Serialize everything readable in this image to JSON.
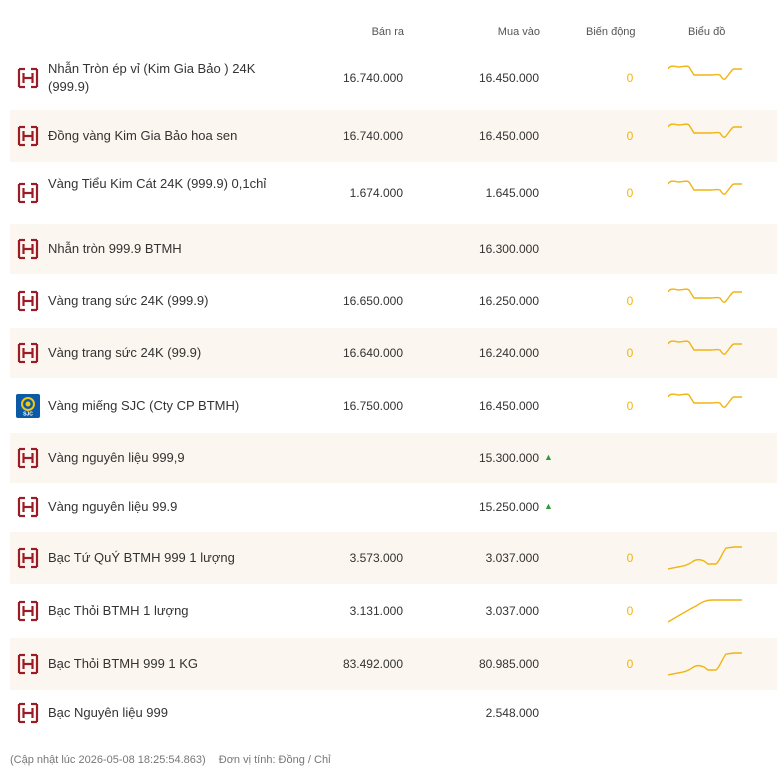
{
  "headers": {
    "sell": "Bán ra",
    "buy": "Mua vào",
    "change": "Biến động",
    "chart": "Biểu đồ"
  },
  "rows": [
    {
      "name": "Nhẫn Tròn ép vỉ (Kim Gia Bảo ) 24K (999.9)",
      "sell": "16.740.000",
      "buy": "16.450.000",
      "change": "0",
      "logo": "btmh-logo-icon",
      "trend": "down"
    },
    {
      "name": "Đồng vàng Kim Gia Bảo hoa sen",
      "sell": "16.740.000",
      "buy": "16.450.000",
      "change": "0",
      "logo": "btmh-logo-icon",
      "trend": "down"
    },
    {
      "name": "Vàng Tiểu Kim Cát 24K (999.9) 0,1chỉ",
      "sell": "1.674.000",
      "buy": "1.645.000",
      "change": "0",
      "logo": "btmh-logo-icon",
      "trend": "down"
    },
    {
      "name": "Nhẫn tròn 999.9 BTMH",
      "sell": "",
      "buy": "16.300.000",
      "change": "",
      "logo": "btmh-logo-icon",
      "trend": "none"
    },
    {
      "name": "Vàng trang sức 24K (999.9)",
      "sell": "16.650.000",
      "buy": "16.250.000",
      "change": "0",
      "logo": "btmh-logo-icon",
      "trend": "down"
    },
    {
      "name": "Vàng trang sức 24K (99.9)",
      "sell": "16.640.000",
      "buy": "16.240.000",
      "change": "0",
      "logo": "btmh-logo-icon",
      "trend": "down"
    },
    {
      "name": "Vàng miếng SJC (Cty CP BTMH)",
      "sell": "16.750.000",
      "buy": "16.450.000",
      "change": "0",
      "logo": "sjc-logo-icon",
      "trend": "down2"
    },
    {
      "name": "Vàng nguyên liệu 999,9",
      "sell": "",
      "buy": "15.300.000",
      "change": "",
      "logo": "btmh-logo-icon",
      "trend": "none",
      "up": "▲"
    },
    {
      "name": "Vàng nguyên liệu 99.9",
      "sell": "",
      "buy": "15.250.000",
      "change": "",
      "logo": "btmh-logo-icon",
      "trend": "none",
      "up": "▲"
    },
    {
      "name": "Bạc Tứ QuÝ BTMH 999 1 lượng",
      "sell": "3.573.000",
      "buy": "3.037.000",
      "change": "0",
      "logo": "btmh-logo-icon",
      "trend": "up"
    },
    {
      "name": "Bạc Thỏi BTMH 1 lượng",
      "sell": "3.131.000",
      "buy": "3.037.000",
      "change": "0",
      "logo": "btmh-logo-icon",
      "trend": "rise"
    },
    {
      "name": "Bạc Thỏi BTMH 999 1 KG",
      "sell": "83.492.000",
      "buy": "80.985.000",
      "change": "0",
      "logo": "btmh-logo-icon",
      "trend": "up"
    },
    {
      "name": "Bạc Nguyên liệu 999",
      "sell": "",
      "buy": "2.548.000",
      "change": "",
      "logo": "btmh-logo-icon",
      "trend": "none"
    }
  ],
  "footer": {
    "updated": "(Cập nhật lúc 2026-05-08 18:25:54.863)",
    "unit": "Đơn vị tính: Đồng / Chỉ"
  },
  "colors": {
    "accent": "#f2b411",
    "logo": "#9b1c24",
    "alt_row": "#fbf6ef",
    "up_arrow": "#2e9e3a"
  }
}
